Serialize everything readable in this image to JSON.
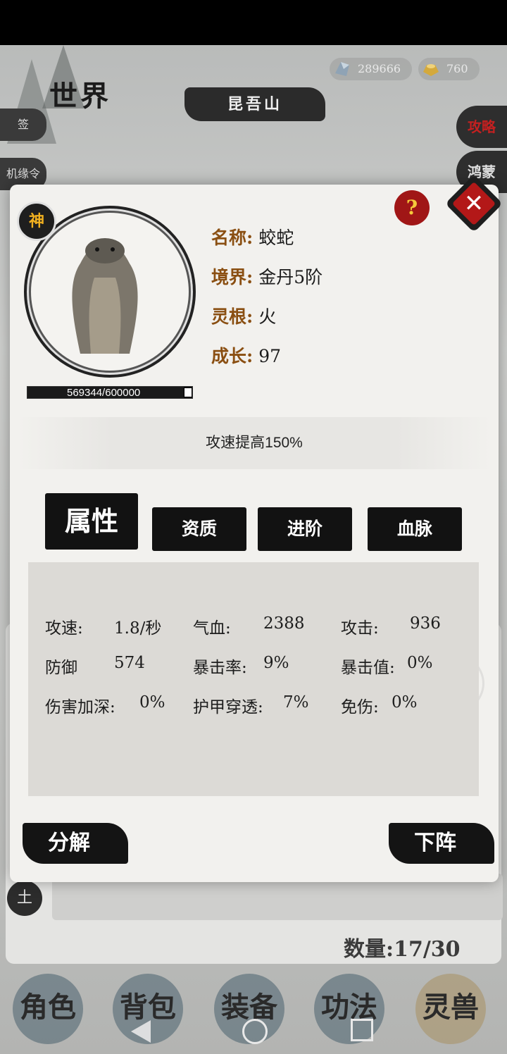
{
  "world": {
    "title": "世界",
    "location": "昆吾山",
    "resources": [
      {
        "icon": "spirit-stone-icon",
        "value": "289666"
      },
      {
        "icon": "gold-ingot-icon",
        "value": "760"
      }
    ],
    "left_side": [
      "签",
      "机缘令"
    ],
    "right_side": [
      {
        "label": "攻略",
        "color": "#c42020"
      },
      {
        "label": "鸿蒙",
        "color": "#e0e0e0"
      }
    ],
    "earth_badge": "土",
    "count_label": "数量:17/30",
    "bottom_tabs": [
      "角色",
      "背包",
      "装备",
      "功法",
      "灵兽"
    ]
  },
  "dialog": {
    "badge": "神",
    "exp_text": "569344/600000",
    "exp_progress": 0.949,
    "info": [
      {
        "key": "名称:",
        "value": "蛟蛇"
      },
      {
        "key": "境界:",
        "value": "金丹5阶"
      },
      {
        "key": "灵根:",
        "value": "火"
      },
      {
        "key": "成长:",
        "value": "97"
      }
    ],
    "help_label": "?",
    "close_label": "✕",
    "skill_text": "攻速提高150%",
    "tabs": [
      "属性",
      "资质",
      "进阶",
      "血脉"
    ],
    "stats": [
      {
        "label": "攻速:",
        "value": "1.8/秒"
      },
      {
        "label": "气血:",
        "value": "2388"
      },
      {
        "label": "攻击:",
        "value": "936"
      },
      {
        "label": "防御",
        "value": "574"
      },
      {
        "label": "暴击率:",
        "value": "9%"
      },
      {
        "label": "暴击值:",
        "value": "0%"
      },
      {
        "label": "伤害加深:",
        "value": "0%"
      },
      {
        "label": "护甲穿透:",
        "value": "7%"
      },
      {
        "label": "免伤:",
        "value": "0%"
      }
    ],
    "decompose_label": "分解",
    "unassign_label": "下阵"
  }
}
